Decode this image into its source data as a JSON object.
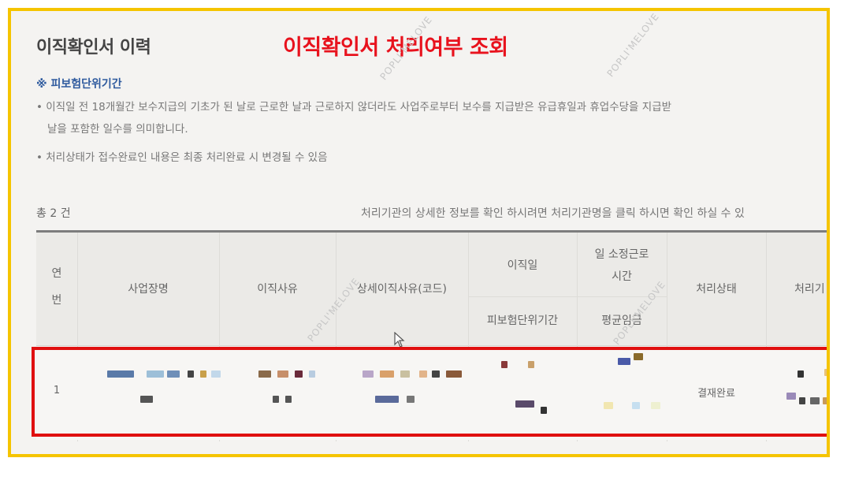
{
  "page": {
    "title": "이직확인서 이력",
    "overlay_title": "이직확인서 처리여부 조회",
    "note_heading": "※ 피보험단위기간",
    "bullets": [
      "• 이직일 전 18개월간 보수지급의 기초가 된 날로 근로한 날과 근로하지 않더라도 사업주로부터 보수를 지급받은 유급휴일과 휴업수당을 지급받",
      "날을 포함한 일수를 의미합니다.",
      "• 처리상태가 접수완료인 내용은 최종 처리완료 시 변경될 수 있음"
    ],
    "total": "총 2 건",
    "guide": "처리기관의 상세한 정보를 확인 하시려면 처리기관명을 클릭 하시면 확인 하실 수 있"
  },
  "table": {
    "headers": {
      "no_line1": "연",
      "no_line2": "번",
      "company": "사업장명",
      "reason": "이직사유",
      "detail_reason": "상세이직사유(코드)",
      "leave_date": "이직일",
      "insured_period": "피보험단위기간",
      "hours_line1": "일 소정근로",
      "hours_line2": "시간",
      "avg_wage": "평균임금",
      "status": "처리상태",
      "agency": "처리기"
    },
    "rows": [
      {
        "no": "1",
        "status": "결재완료"
      }
    ]
  },
  "watermark": "POPLI'MELOVE",
  "colors": {
    "frame": "#f5c400",
    "overlay_title": "#e8121d",
    "highlight": "#e01010",
    "note_heading": "#2e5a9e"
  }
}
